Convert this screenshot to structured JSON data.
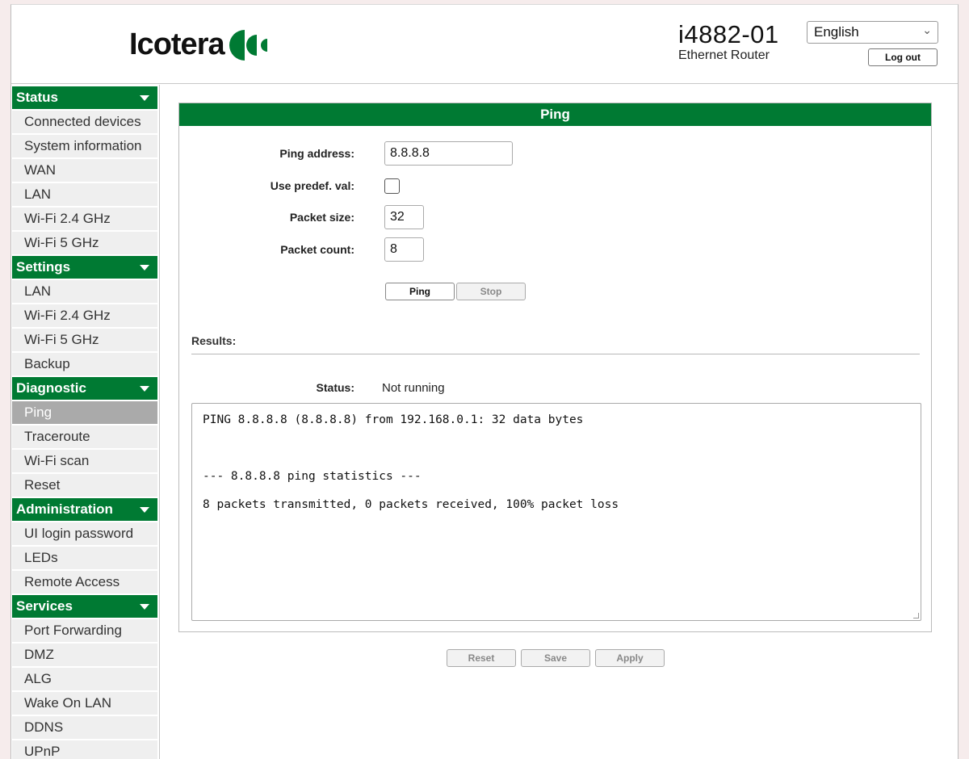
{
  "header": {
    "logo_text": "Icotera",
    "model": "i4882-01",
    "model_subtitle": "Ethernet Router",
    "language": "English",
    "logout_label": "Log out"
  },
  "sidebar": {
    "sections": [
      {
        "title": "Status",
        "items": [
          "Connected devices",
          "System information",
          "WAN",
          "LAN",
          "Wi-Fi 2.4 GHz",
          "Wi-Fi 5 GHz"
        ]
      },
      {
        "title": "Settings",
        "items": [
          "LAN",
          "Wi-Fi 2.4 GHz",
          "Wi-Fi 5 GHz",
          "Backup"
        ]
      },
      {
        "title": "Diagnostic",
        "items": [
          "Ping",
          "Traceroute",
          "Wi-Fi scan",
          "Reset"
        ]
      },
      {
        "title": "Administration",
        "items": [
          "UI login password",
          "LEDs",
          "Remote Access"
        ]
      },
      {
        "title": "Services",
        "items": [
          "Port Forwarding",
          "DMZ",
          "ALG",
          "Wake On LAN",
          "DDNS",
          "UPnP"
        ]
      }
    ],
    "active_item": "Ping"
  },
  "ping": {
    "title": "Ping",
    "address_label": "Ping address:",
    "address_value": "8.8.8.8",
    "predef_label": "Use predef. val:",
    "size_label": "Packet size:",
    "size_value": "32",
    "count_label": "Packet count:",
    "count_value": "8",
    "ping_button": "Ping",
    "stop_button": "Stop",
    "results_label": "Results:",
    "status_label": "Status:",
    "status_value": "Not running",
    "output": [
      "PING 8.8.8.8 (8.8.8.8) from 192.168.0.1: 32 data bytes",
      "--- 8.8.8.8 ping statistics ---",
      "8 packets transmitted, 0 packets received, 100% packet loss"
    ]
  },
  "footer": {
    "reset_label": "Reset",
    "save_label": "Save",
    "apply_label": "Apply"
  },
  "colors": {
    "brand_green": "#007a33",
    "active_item": "#aaaaaa"
  }
}
